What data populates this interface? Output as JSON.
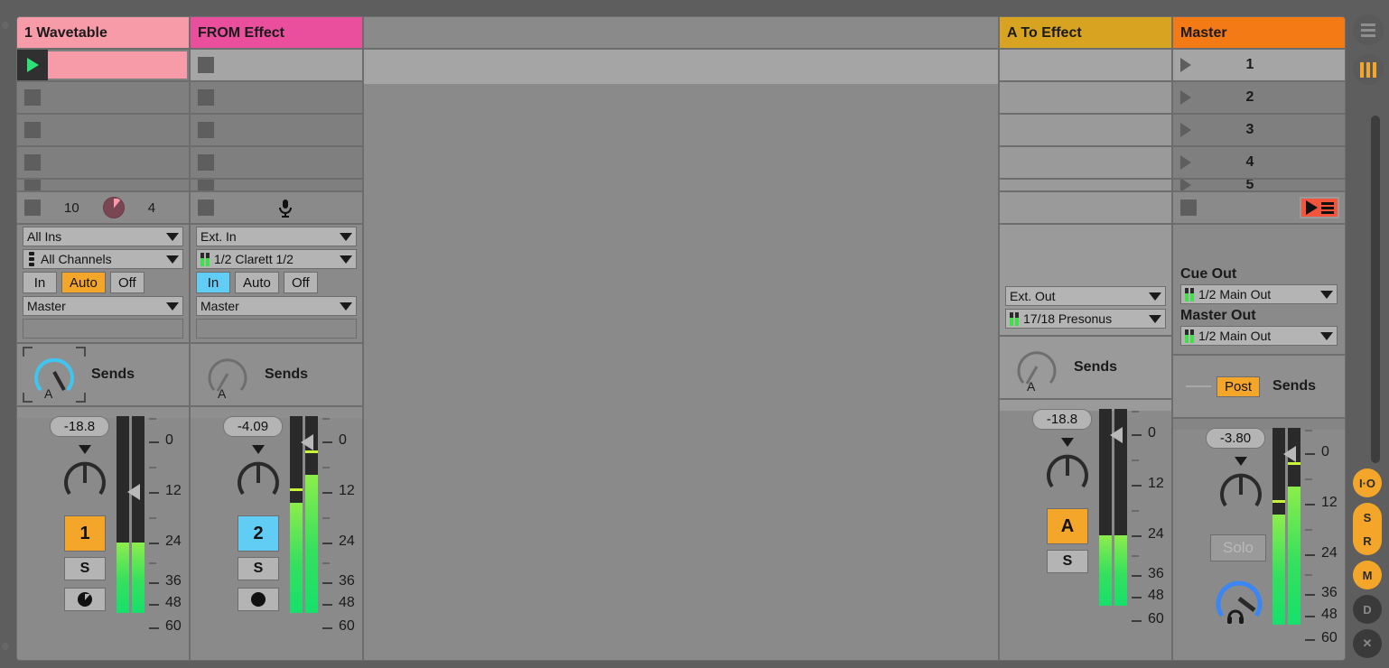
{
  "app": {
    "name": "Ableton Live Session View"
  },
  "tracks": [
    {
      "name": "1 Wavetable",
      "header_color": "#f89ba9",
      "slots": [
        {
          "state": "playing",
          "clip": true
        },
        {
          "state": "empty"
        },
        {
          "state": "empty"
        },
        {
          "state": "empty"
        },
        {
          "state": "empty"
        }
      ],
      "ctrl": {
        "left_num": "10",
        "right_num": "4"
      },
      "io": {
        "input_type": "All Ins",
        "input_channel": "All Channels",
        "monitor": {
          "in": "In",
          "auto": "Auto",
          "off": "Off",
          "active": "Auto"
        },
        "output_type": "Master",
        "output_channel": ""
      },
      "sends": {
        "label": "Sends",
        "knob_label": "A",
        "selected": true,
        "accent": "#3ec6f0"
      },
      "mixer": {
        "volume": "-18.8",
        "track_number": "1",
        "number_color": "#f4a62a",
        "solo": "S",
        "arm_icon": "clock-record-icon",
        "meter_left_pct": 36,
        "meter_right_pct": 36,
        "peak_left_pct": null,
        "peak_right_pct": null,
        "fader_marker_db": "12"
      }
    },
    {
      "name": "FROM Effect",
      "header_color": "#e94f9c",
      "slots": [
        {
          "state": "empty-light"
        },
        {
          "state": "empty"
        },
        {
          "state": "empty"
        },
        {
          "state": "empty"
        },
        {
          "state": "empty"
        }
      ],
      "ctrl": {
        "icon": "microphone-icon"
      },
      "io": {
        "input_type": "Ext. In",
        "input_channel": "1/2 Clarett 1/2",
        "monitor": {
          "in": "In",
          "auto": "Auto",
          "off": "Off",
          "active": "In"
        },
        "output_type": "Master",
        "output_channel": ""
      },
      "sends": {
        "label": "Sends",
        "knob_label": "A",
        "selected": false,
        "accent": "#6e6e6e"
      },
      "mixer": {
        "volume": "-4.09",
        "track_number": "2",
        "number_color": "#62cdf4",
        "solo": "S",
        "arm_icon": "record-dot-icon",
        "meter_left_pct": 56,
        "meter_right_pct": 70,
        "peak_left_pct": 62,
        "peak_right_pct": 81,
        "fader_marker_db": "0"
      }
    }
  ],
  "return_track": {
    "name": "A To Effect",
    "header_color": "#d8a321",
    "io": {
      "output_type": "Ext. Out",
      "output_channel": "17/18 Presonus"
    },
    "sends": {
      "label": "Sends",
      "knob_label": "A"
    },
    "mixer": {
      "volume": "-18.8",
      "track_number": "A",
      "number_color": "#f4a62a",
      "solo": "S",
      "meter_left_pct": 36,
      "meter_right_pct": 36,
      "fader_marker_db": "0"
    }
  },
  "master": {
    "name": "Master",
    "header_color": "#f47a16",
    "scenes": [
      {
        "label": "1",
        "selected": true
      },
      {
        "label": "2",
        "selected": false
      },
      {
        "label": "3",
        "selected": false
      },
      {
        "label": "4",
        "selected": false
      },
      {
        "label": "5",
        "selected": false
      }
    ],
    "scene_launch_icon": "scene-launch-icon",
    "cue_out": {
      "title": "Cue Out",
      "value": "1/2 Main Out"
    },
    "master_out": {
      "title": "Master Out",
      "value": "1/2 Main Out"
    },
    "sends": {
      "label": "Sends",
      "post_label": "Post"
    },
    "mixer": {
      "volume": "-3.80",
      "solo": "Solo",
      "cue_knob_icon": "headphones-icon",
      "meter_left_pct": 56,
      "meter_right_pct": 70,
      "peak_left_pct": 62,
      "peak_right_pct": 81,
      "fader_marker_db": "0"
    }
  },
  "meter_scale": {
    "labels": [
      "0",
      "12",
      "24",
      "36",
      "48",
      "60"
    ]
  },
  "rail": {
    "top": [
      {
        "name": "menu-icon",
        "label": ""
      },
      {
        "name": "bars-icon",
        "label": ""
      }
    ],
    "buttons": [
      {
        "label": "I·O",
        "name": "io-toggle",
        "active": true
      },
      {
        "label": "S",
        "name": "sends-toggle",
        "active": true
      },
      {
        "label": "R",
        "name": "returns-toggle",
        "active": true
      },
      {
        "label": "M",
        "name": "mixer-toggle",
        "active": true
      },
      {
        "label": "D",
        "name": "delay-toggle",
        "active": false
      },
      {
        "label": "✕",
        "name": "close-toggle",
        "active": false
      }
    ]
  }
}
